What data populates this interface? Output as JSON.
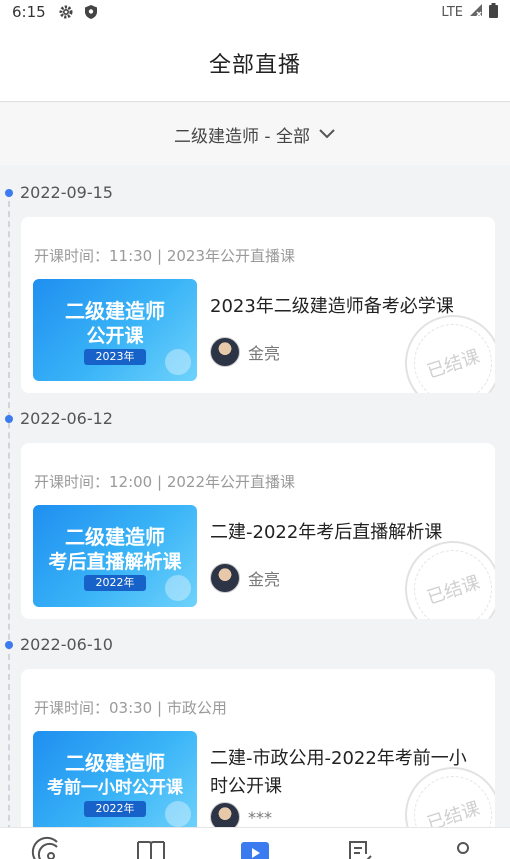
{
  "status_bar": {
    "time": "6:15",
    "icons": [
      "gear-icon",
      "shield-icon"
    ],
    "network": "LTE",
    "right_icons": [
      "signal-icon",
      "battery-icon"
    ]
  },
  "header": {
    "title": "全部直播"
  },
  "filter": {
    "label": "二级建造师 - 全部",
    "icon": "chevron-down-icon"
  },
  "groups": [
    {
      "date": "2022-09-15",
      "card": {
        "meta": "开课时间：11:30 | 2023年公开直播课",
        "thumb": {
          "line1": "二级建造师",
          "line2": "公开课",
          "year": "2023年"
        },
        "title": "2023年二级建造师备考必学课",
        "teacher": "金亮",
        "stamp": "已结课"
      }
    },
    {
      "date": "2022-06-12",
      "card": {
        "meta": "开课时间：12:00 | 2022年公开直播课",
        "thumb": {
          "line1": "二级建造师",
          "line2": "考后直播解析课",
          "year": "2022年"
        },
        "title": "二建-2022年考后直播解析课",
        "teacher": "金亮",
        "stamp": "已结课"
      }
    },
    {
      "date": "2022-06-10",
      "card": {
        "meta": "开课时间：03:30 | 市政公用",
        "thumb": {
          "line1": "二级建造师",
          "line2": "考前一小时公开课",
          "year": "2022年"
        },
        "title": "二建-市政公用-2022年考前一小时公开课",
        "teacher": "***",
        "stamp": "已结课"
      }
    }
  ],
  "bottom_nav": {
    "items": [
      "live-signal-icon",
      "book-icon",
      "video-play-icon",
      "notes-edit-icon",
      "profile-icon"
    ],
    "active_index": 2,
    "active_color": "#3b7bf0",
    "inactive_color": "#555555"
  },
  "colors": {
    "accent": "#3b7bf0",
    "thumb_blue": "#1f8ff0",
    "stamp_gray": "#d0d0d0"
  }
}
